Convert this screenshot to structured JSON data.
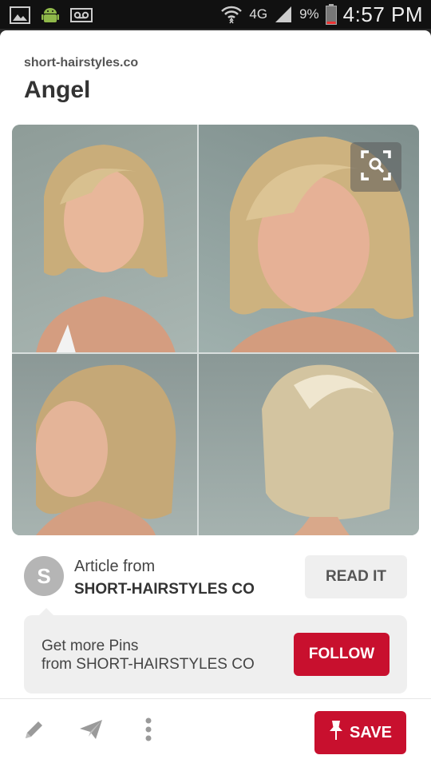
{
  "status_bar": {
    "network": "4G",
    "battery": "9%",
    "time": "4:57 PM"
  },
  "pin": {
    "source_domain": "short-hairstyles.co",
    "title": "Angel"
  },
  "article": {
    "avatar_letter": "S",
    "label": "Article from",
    "source": "SHORT-HAIRSTYLES CO",
    "read_button": "READ IT"
  },
  "follow": {
    "line1": "Get more Pins",
    "line2": "from SHORT-HAIRSTYLES CO",
    "button": "FOLLOW"
  },
  "bottom_bar": {
    "save_button": "SAVE"
  },
  "colors": {
    "accent_red": "#c8102e",
    "button_gray": "#efefef"
  },
  "icons": [
    "image-icon",
    "android-icon",
    "voicemail-icon",
    "wifi-icon",
    "signal-icon",
    "battery-icon",
    "visual-search-icon",
    "edit-icon",
    "send-icon",
    "more-icon",
    "pin-icon"
  ]
}
